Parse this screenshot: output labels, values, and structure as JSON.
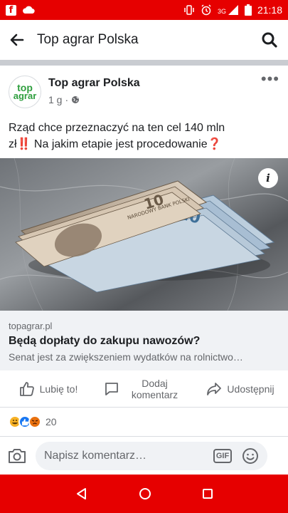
{
  "status_bar": {
    "time": "21:18",
    "network": "3G",
    "icons": [
      "facebook-icon",
      "cloud-icon",
      "vibrate-icon",
      "alarm-icon",
      "signal-icon",
      "battery-icon"
    ]
  },
  "app_bar": {
    "title": "Top agrar Polska",
    "back_icon": "arrow-left-icon",
    "search_icon": "search-icon"
  },
  "post": {
    "avatar_line1": "top",
    "avatar_line2": "agrar",
    "author": "Top agrar Polska",
    "time": "1 g",
    "time_separator": "·",
    "privacy_icon": "globe-icon",
    "more": "•••",
    "text_line1": "Rząd chce przeznaczyć na ten cel 140 mln",
    "text_line2_prefix": "zł",
    "text_line2_emoji1": "‼️",
    "text_line2_middle": " Na jakim etapie jest procedowanie",
    "text_line2_emoji2": "❓",
    "image_info": "i",
    "link": {
      "domain": "topagrar.pl",
      "title": "Będą dopłaty do zakupu nawozów?",
      "description": "Senat jest za zwiększeniem wydatków na rolnictwo…"
    }
  },
  "actions": {
    "like": "Lubię to!",
    "comment_line1": "Dodaj",
    "comment_line2": "komentarz",
    "share": "Udostępnij"
  },
  "reactions": {
    "types": [
      "haha",
      "like",
      "angry"
    ],
    "count": "20"
  },
  "comment_bar": {
    "placeholder": "Napisz komentarz…",
    "gif_label": "GIF"
  },
  "colors": {
    "status_bar": "#e60000",
    "accent": "#1877f2",
    "brand_green": "#2e9e3e"
  }
}
